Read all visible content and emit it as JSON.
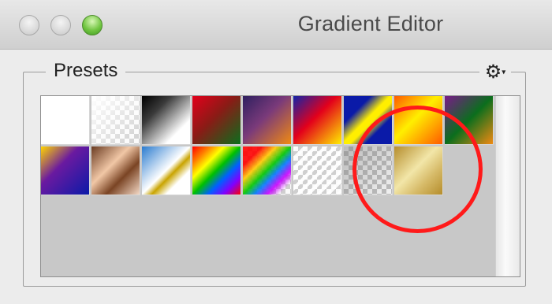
{
  "window": {
    "title": "Gradient Editor"
  },
  "presets": {
    "label": "Presets",
    "menu_icon": "gear-icon",
    "swatches": [
      {
        "name": "white"
      },
      {
        "name": "white-to-transparent"
      },
      {
        "name": "black-to-white"
      },
      {
        "name": "red-green"
      },
      {
        "name": "violet-orange"
      },
      {
        "name": "blue-red-yellow"
      },
      {
        "name": "blue-yellow-blue"
      },
      {
        "name": "orange-yellow-orange"
      },
      {
        "name": "violet-green-orange"
      },
      {
        "name": "yellow-violet-orange-blue"
      },
      {
        "name": "copper"
      },
      {
        "name": "chrome"
      },
      {
        "name": "spectrum"
      },
      {
        "name": "transparent-rainbow"
      },
      {
        "name": "transparent-stripes"
      },
      {
        "name": "neutral-density"
      },
      {
        "name": "gold"
      }
    ]
  },
  "colors": {
    "annotation": "#ff1a1a",
    "zoom_button": "#72c642"
  }
}
